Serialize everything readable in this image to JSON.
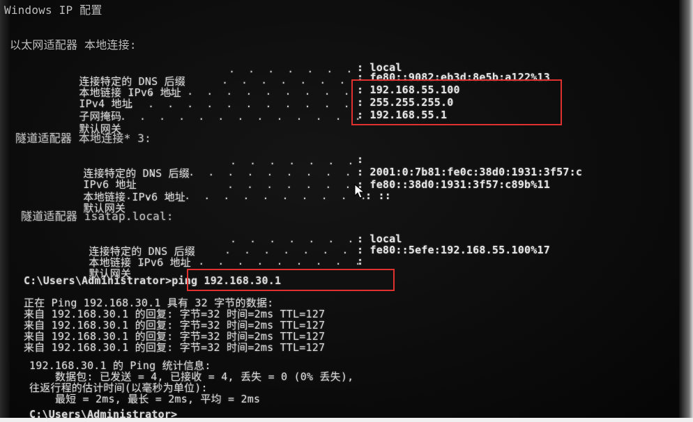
{
  "console": {
    "title": "Windows IP 配置",
    "adapters": [
      {
        "header": "以太网适配器 本地连接:",
        "rows": [
          {
            "label": "连接特定的 DNS 后缀",
            "dots": ". . . . . . .",
            "value": ": local"
          },
          {
            "label": "本地链接 IPv6 地址",
            "dots": ". . . . . . .",
            "value": ": fe80::9082:eb3d:8e5b:a122%13"
          },
          {
            "label": "IPv4 地址",
            "dots": ". . . . . . . . . . . .",
            "value": ": 192.168.55.100"
          },
          {
            "label": "子网掩码",
            "dots": ". . . . . . . . . . . .",
            "value": ": 255.255.255.0"
          },
          {
            "label": "默认网关",
            "dots": ". . . . . . . . . . . . .",
            "value": ": 192.168.55.1"
          }
        ]
      },
      {
        "header": "隧道适配器 本地连接* 3:",
        "rows": [
          {
            "label": "连接特定的 DNS 后缀",
            "dots": ". . . . . . .",
            "value": ":"
          },
          {
            "label": "IPv6 地址",
            "dots": ". . . . . . . . . . . .",
            "value": ": 2001:0:7b81:fe0c:38d0:1931:3f57:c"
          },
          {
            "label": "本地链接 IPv6 地址",
            "dots": ". . . . . . .",
            "value": ": fe80::38d0:1931:3f57:c89b%11"
          },
          {
            "label": "默认网关",
            "dots": ". . . . . . . . . . . . .",
            "value": ": ::"
          }
        ]
      },
      {
        "header": "隧道适配器 isatap.local:",
        "rows": [
          {
            "label": "连接特定的 DNS 后缀",
            "dots": ". . . . . . .",
            "value": ": local"
          },
          {
            "label": "本地链接 IPv6 地址",
            "dots": ". . . . . . .",
            "value": ": fe80::5efe:192.168.55.100%17"
          },
          {
            "label": "默认网关",
            "dots": ". . . . . . . . . . . . .",
            "value": ":"
          }
        ]
      }
    ],
    "command_line": "C:\\Users\\Administrator>ping 192.168.30.1",
    "ping_header": "正在 Ping 192.168.30.1 具有 32 字节的数据:",
    "ping_replies": [
      "来自 192.168.30.1 的回复: 字节=32 时间=2ms TTL=127",
      "来自 192.168.30.1 的回复: 字节=32 时间=2ms TTL=127",
      "来自 192.168.30.1 的回复: 字节=32 时间=2ms TTL=127",
      "来自 192.168.30.1 的回复: 字节=32 时间=2ms TTL=127"
    ],
    "stats_header": "192.168.30.1 的 Ping 统计信息:",
    "stats_packets": "    数据包: 已发送 = 4, 已接收 = 4, 丢失 = 0 (0% 丢失),",
    "stats_rtt_header": "往返行程的估计时间(以毫秒为单位):",
    "stats_rtt": "    最短 = 2ms, 最长 = 2ms, 平均 = 2ms",
    "prompt": "C:\\Users\\Administrator>"
  },
  "colors": {
    "background": "#0a0a0a",
    "text": "#d9d9d9",
    "highlight_box": "#e0312f"
  },
  "icons": {
    "pointer": "mouse-pointer-icon"
  }
}
